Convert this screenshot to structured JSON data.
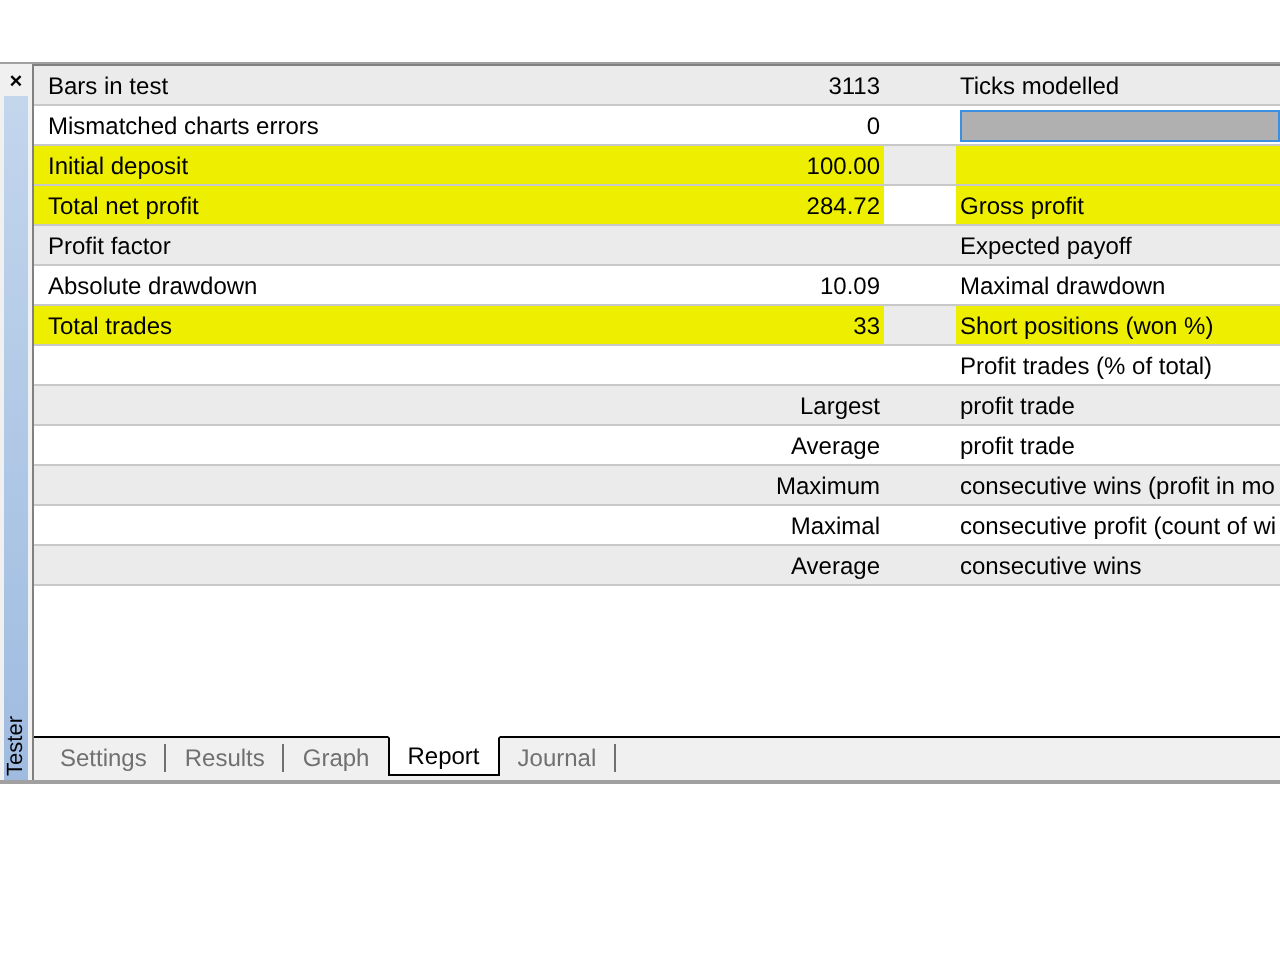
{
  "panel": {
    "title": "Tester",
    "close": "×"
  },
  "rows": [
    {
      "label": "Bars in test",
      "value": "3113",
      "label_2": "Ticks modelled",
      "highlight": [
        false,
        false,
        false
      ]
    },
    {
      "label": "Mismatched charts errors",
      "value": "0",
      "meter": {
        "level": 1
      },
      "highlight": [
        false,
        false,
        false
      ]
    },
    {
      "label": "Initial deposit",
      "value": "100.00",
      "highlight": [
        true,
        true,
        true
      ]
    },
    {
      "label": "Total net profit",
      "value": "284.72",
      "label_2": "Gross profit",
      "highlight": [
        true,
        true,
        true
      ]
    },
    {
      "label": "Profit factor",
      "label_2": "Expected payoff",
      "highlight": [
        false,
        false,
        false
      ]
    },
    {
      "label": "Absolute drawdown",
      "value": "10.09",
      "label_2": "Maximal drawdown",
      "highlight": [
        false,
        false,
        false
      ]
    },
    {
      "label": "Total trades",
      "value": "33",
      "label_2": "Short positions (won %)",
      "highlight": [
        true,
        true,
        true
      ]
    },
    {
      "label_2": "Profit trades (% of total)",
      "highlight": [
        false,
        false,
        false
      ]
    },
    {
      "value": "Largest",
      "label_2": "profit trade",
      "highlight": [
        false,
        false,
        false
      ]
    },
    {
      "value": "Average",
      "label_2": "profit trade",
      "highlight": [
        false,
        false,
        false
      ]
    },
    {
      "value": "Maximum",
      "label_2": "consecutive wins (profit in mo",
      "highlight": [
        false,
        false,
        false
      ]
    },
    {
      "value": "Maximal",
      "label_2": "consecutive profit (count of wi",
      "highlight": [
        false,
        false,
        false
      ]
    },
    {
      "value": "Average",
      "label_2": "consecutive wins",
      "highlight": [
        false,
        false,
        false
      ]
    }
  ],
  "tabs": [
    {
      "label": "Settings",
      "selected": false
    },
    {
      "label": "Results",
      "selected": false
    },
    {
      "label": "Graph",
      "selected": false
    },
    {
      "label": "Report",
      "selected": true
    },
    {
      "label": "Journal",
      "selected": false
    }
  ]
}
